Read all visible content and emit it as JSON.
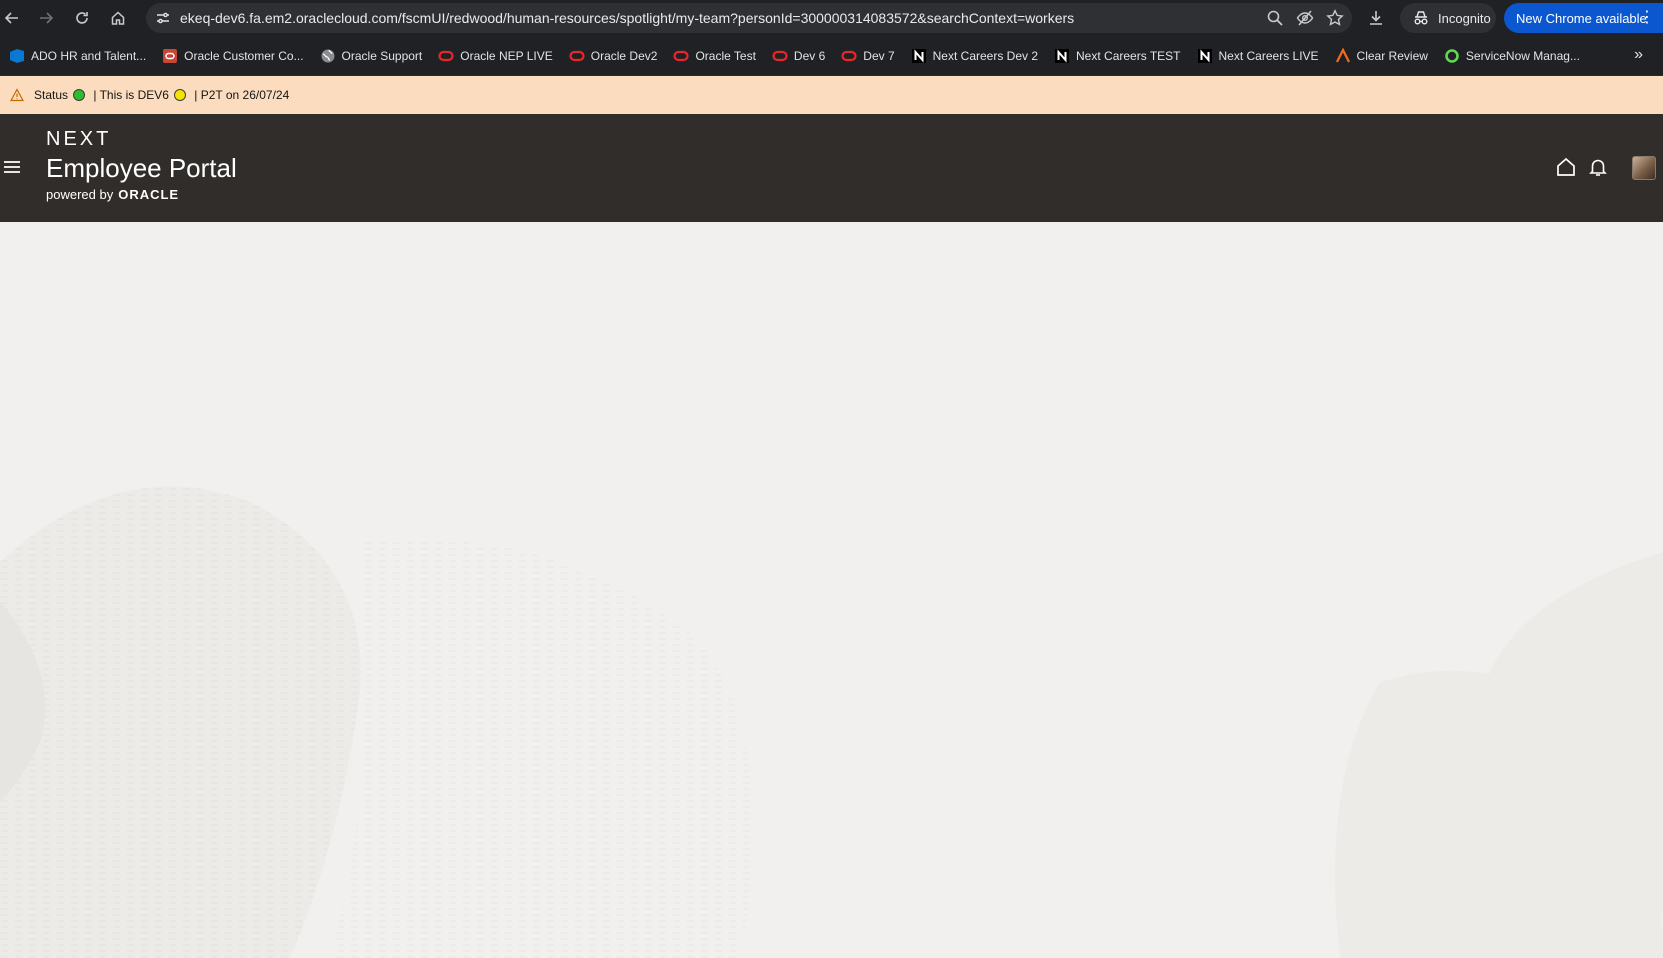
{
  "browser": {
    "url": "ekeq-dev6.fa.em2.oraclecloud.com/fscmUI/redwood/human-resources/spotlight/my-team?personId=300000314083572&searchContext=workers",
    "incognito_label": "Incognito",
    "update_label": "New Chrome available",
    "kebab": "⋮",
    "more_bookmarks": "»"
  },
  "bookmarks": [
    {
      "label": "ADO HR and Talent...",
      "icon": "ado-icon",
      "color": "#0a78d4"
    },
    {
      "label": "Oracle Customer Co...",
      "icon": "oracle-square-icon",
      "color": "#c74634"
    },
    {
      "label": "Oracle Support",
      "icon": "globe-icon",
      "color": "#c8cacd"
    },
    {
      "label": "Oracle NEP LIVE",
      "icon": "oracle-o-icon",
      "color": "#e8262b"
    },
    {
      "label": "Oracle Dev2",
      "icon": "oracle-o-icon",
      "color": "#e8262b"
    },
    {
      "label": "Oracle Test",
      "icon": "oracle-o-icon",
      "color": "#e8262b"
    },
    {
      "label": "Dev 6",
      "icon": "oracle-o-icon",
      "color": "#e8262b"
    },
    {
      "label": "Dev 7",
      "icon": "oracle-o-icon",
      "color": "#e8262b"
    },
    {
      "label": "Next Careers Dev 2",
      "icon": "next-n-icon",
      "color": "#ffffff"
    },
    {
      "label": "Next Careers TEST",
      "icon": "next-n-icon",
      "color": "#ffffff"
    },
    {
      "label": "Next Careers LIVE",
      "icon": "next-n-icon",
      "color": "#ffffff"
    },
    {
      "label": "Clear Review",
      "icon": "clear-review-icon",
      "color": "#f26b21"
    },
    {
      "label": "ServiceNow Manag...",
      "icon": "servicenow-icon",
      "color": "#62d84e"
    }
  ],
  "status_banner": {
    "prefix": "Status",
    "middle": " | This is DEV6",
    "suffix": " | P2T on 26/07/24",
    "dot1_color": "#2ebd2e",
    "dot2_color": "#f5e400"
  },
  "app_header": {
    "brand_top": "NEXT",
    "brand_title": "Employee Portal",
    "powered_by": "powered by",
    "oracle": "ORACLE"
  },
  "colors": {
    "header_bg": "#312d2a",
    "banner_bg": "#fbdcbe",
    "content_bg": "#f1f0ee",
    "chrome_bg": "#202124"
  }
}
